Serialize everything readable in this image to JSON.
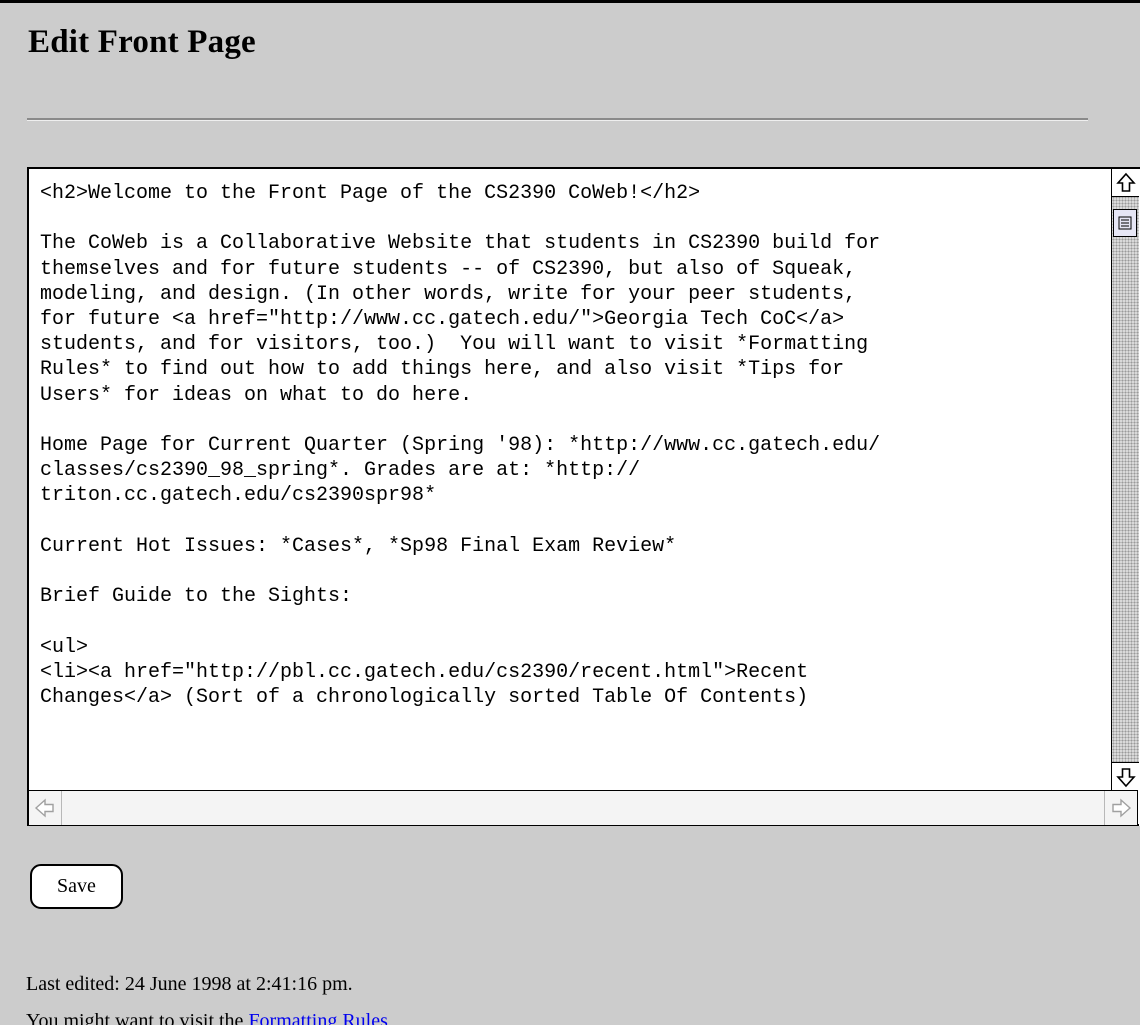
{
  "page": {
    "title": "Edit Front Page"
  },
  "editor": {
    "content": "<h2>Welcome to the Front Page of the CS2390 CoWeb!</h2>\n\nThe CoWeb is a Collaborative Website that students in CS2390 build for\nthemselves and for future students -- of CS2390, but also of Squeak,\nmodeling, and design. (In other words, write for your peer students,\nfor future <a href=\"http://www.cc.gatech.edu/\">Georgia Tech CoC</a>\nstudents, and for visitors, too.)  You will want to visit *Formatting\nRules* to find out how to add things here, and also visit *Tips for\nUsers* for ideas on what to do here.\n\nHome Page for Current Quarter (Spring '98): *http://www.cc.gatech.edu/\nclasses/cs2390_98_spring*. Grades are at: *http://\ntriton.cc.gatech.edu/cs2390spr98*\n\nCurrent Hot Issues: *Cases*, *Sp98 Final Exam Review*\n\nBrief Guide to the Sights:\n\n<ul>\n<li><a href=\"http://pbl.cc.gatech.edu/cs2390/recent.html\">Recent\nChanges</a> (Sort of a chronologically sorted Table Of Contents)"
  },
  "icons": {
    "scroll_up": "scroll-up-arrow-icon",
    "scroll_down": "scroll-down-arrow-icon",
    "scroll_left": "scroll-left-arrow-icon",
    "scroll_right": "scroll-right-arrow-icon",
    "thumb": "scroll-thumb-grip-icon"
  },
  "actions": {
    "save_label": "Save"
  },
  "footer": {
    "last_edited": "Last edited: 24 June 1998 at 2:41:16 pm.",
    "visit_prefix": "You might want to visit the ",
    "formatting_rules_link": "Formatting Rules"
  },
  "colors": {
    "background": "#cccccc",
    "link": "#0000ee"
  }
}
